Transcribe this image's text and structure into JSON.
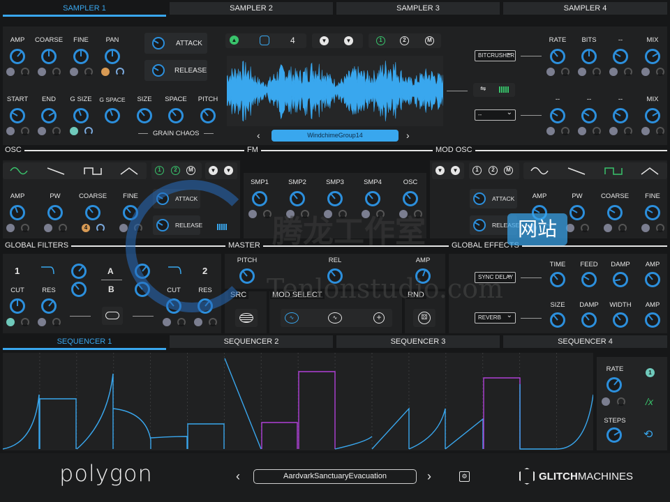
{
  "top_tabs": [
    "SAMPLER 1",
    "SAMPLER 2",
    "SAMPLER 3",
    "SAMPLER 4"
  ],
  "sampler": {
    "row1_labels": [
      "AMP",
      "COARSE",
      "FINE",
      "PAN"
    ],
    "row2_labels": [
      "START",
      "END",
      "G SIZE",
      "G SPACE",
      "SIZE",
      "SPACE",
      "PITCH"
    ],
    "grain_chaos": "GRAIN CHAOS",
    "attack": "ATTACK",
    "release": "RELEASE",
    "voice_count": "4",
    "mode_1": "1",
    "mode_2": "2",
    "mode_m": "M",
    "sample_name": "WindchimeGroup14",
    "fx_select": "BITCRUSHER",
    "fx_select_2": "--",
    "fx_row1_labels": [
      "RATE",
      "BITS",
      "--",
      "MIX"
    ],
    "fx_row2_labels": [
      "--",
      "--",
      "--",
      "MIX"
    ]
  },
  "sections": {
    "osc": "OSC",
    "fm": "FM",
    "mod_osc": "MOD OSC",
    "global_filters": "GLOBAL FILTERS",
    "master": "MASTER",
    "global_effects": "GLOBAL EFFECTS"
  },
  "osc": {
    "labels": [
      "AMP",
      "PW",
      "COARSE",
      "FINE"
    ],
    "attack": "ATTACK",
    "release": "RELEASE",
    "coarse_badge": "4"
  },
  "fm": {
    "labels": [
      "SMP1",
      "SMP2",
      "SMP3",
      "SMP4",
      "OSC"
    ]
  },
  "mod_osc": {
    "labels": [
      "AMP",
      "PW",
      "COARSE",
      "FINE"
    ],
    "attack": "ATTACK",
    "release": "RELEASE"
  },
  "filters": {
    "f1": "1",
    "f2": "2",
    "a": "A",
    "b": "B",
    "cut": "CUT",
    "res": "RES"
  },
  "master": {
    "pitch": "PITCH",
    "rel": "REL",
    "amp": "AMP",
    "src": "SRC",
    "mod_select": "MOD SELECT",
    "rnd": "RND"
  },
  "effects": {
    "fx1": "SYNC DELAY",
    "fx2": "REVERB",
    "row1_labels": [
      "TIME",
      "FEED",
      "DAMP",
      "AMP"
    ],
    "row2_labels": [
      "SIZE",
      "DAMP",
      "WIDTH",
      "AMP"
    ]
  },
  "seq_tabs": [
    "SEQUENCER 1",
    "SEQUENCER 2",
    "SEQUENCER 3",
    "SEQUENCER 4"
  ],
  "seq_side": {
    "rate": "RATE",
    "steps": "STEPS"
  },
  "footer": {
    "logo": "polygon",
    "preset": "AardvarkSanctuaryEvacuation",
    "brand_bold": "GLITCH",
    "brand_rest": "MACHINES"
  },
  "watermark": {
    "cn": "腾龙工作室",
    "net": "网站",
    "en": "Tenlonstudio.com"
  },
  "colors": {
    "accent": "#39a7ee",
    "purple": "#b040d8",
    "green": "#39c46c"
  }
}
